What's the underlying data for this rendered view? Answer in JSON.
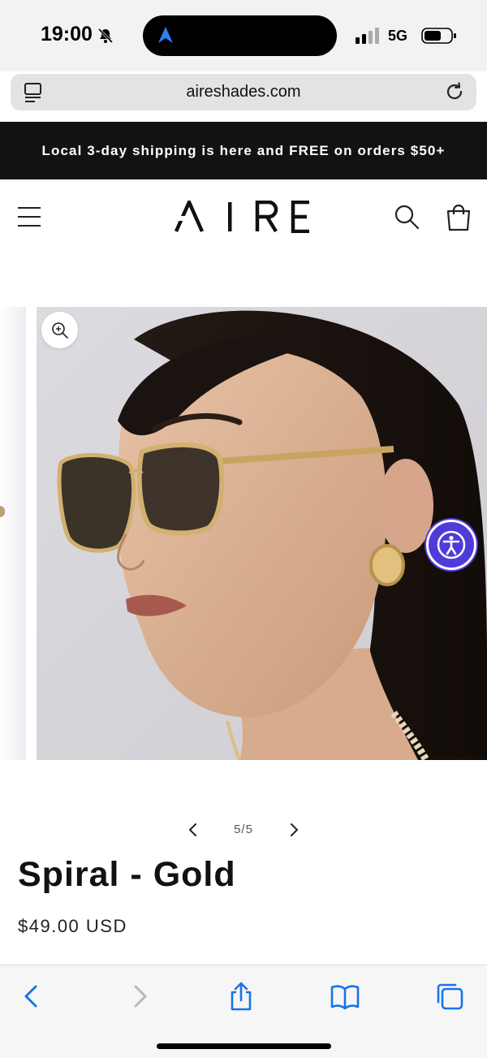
{
  "status_bar": {
    "time": "19:00",
    "network": "5G",
    "icons": [
      "bell-muted-icon",
      "location-arrow-icon",
      "signal-icon",
      "battery-icon"
    ]
  },
  "browser": {
    "url": "aireshades.com",
    "icons": [
      "tabs-overview-icon",
      "reload-icon"
    ]
  },
  "announcement": {
    "text": "Local 3-day shipping is here and FREE on orders $50+"
  },
  "header": {
    "logo_text": "AIRE",
    "icons": [
      "menu-icon",
      "search-icon",
      "cart-icon"
    ]
  },
  "gallery": {
    "counter": "5/5",
    "icons": [
      "zoom-in-icon",
      "chevron-left-icon",
      "chevron-right-icon",
      "accessibility-icon"
    ]
  },
  "product": {
    "title": "Spiral - Gold",
    "price": "$49.00 USD"
  },
  "toolbar": {
    "icons": [
      "back-icon",
      "forward-icon",
      "share-icon",
      "bookmarks-icon",
      "tabs-icon"
    ]
  },
  "colors": {
    "announcement_bg": "#121212",
    "accessibility_button": "#4f3bd8",
    "browser_blue": "#1a73e8"
  }
}
